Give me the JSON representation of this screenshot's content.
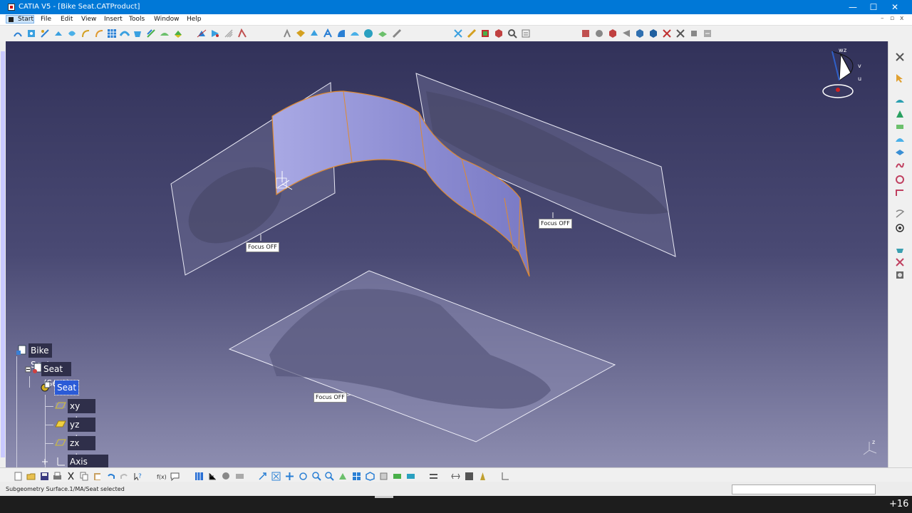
{
  "window": {
    "title": "CATIA V5 - [Bike Seat.CATProduct]",
    "minimize": "—",
    "maximize": "☐",
    "close": "✕"
  },
  "menu": {
    "start": "Start",
    "items": [
      "File",
      "Edit",
      "View",
      "Insert",
      "Tools",
      "Window",
      "Help"
    ],
    "mdi_min": "–",
    "mdi_restore": "▫",
    "mdi_close": "x"
  },
  "tree": {
    "root": "Bike Seat",
    "product": "Seat (Seat)",
    "part": "Seat",
    "children": [
      "xy plane",
      "yz plane",
      "zx plane",
      "Axis Systems"
    ]
  },
  "viewport": {
    "focus_labels": [
      "Focus OFF",
      "Focus OFF",
      "Focus OFF"
    ],
    "compass_axes": [
      "w",
      "z",
      "v",
      "u"
    ],
    "axis_labels": [
      "x",
      "y",
      "z"
    ]
  },
  "status": {
    "message": "Subgeometry Surface.1/MA/Seat selected"
  },
  "taskbar": {
    "count": "+16"
  },
  "colors": {
    "title_bar": "#0078d7",
    "selection": "#2b5bd7",
    "viewport_top": "#32325a",
    "viewport_bottom": "#8d8db0",
    "edge_highlight": "#e08a30"
  }
}
